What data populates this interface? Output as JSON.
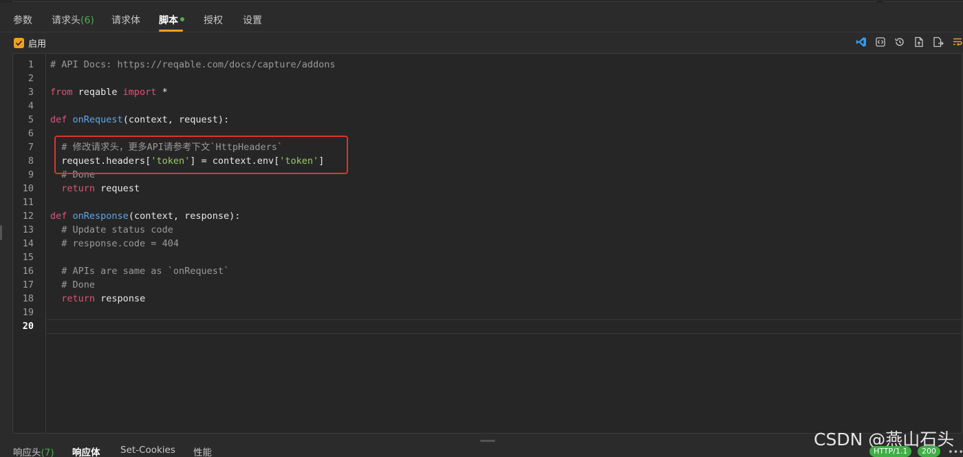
{
  "tabs": [
    {
      "label": "参数",
      "count": ""
    },
    {
      "label": "请求头",
      "count": "(6)"
    },
    {
      "label": "请求体",
      "count": ""
    },
    {
      "label": "脚本",
      "count": ""
    },
    {
      "label": "授权",
      "count": ""
    },
    {
      "label": "设置",
      "count": ""
    }
  ],
  "active_tab": "脚本",
  "enable": {
    "label": "启用",
    "checked": true
  },
  "toolbar_icons": [
    "vscode-icon",
    "code-brackets-icon",
    "history-icon",
    "file-export-icon",
    "file-output-icon",
    "word-wrap-icon"
  ],
  "editor": {
    "current_line": 20,
    "lines": [
      "1",
      "2",
      "3",
      "4",
      "5",
      "6",
      "7",
      "8",
      "9",
      "10",
      "11",
      "12",
      "13",
      "14",
      "15",
      "16",
      "17",
      "18",
      "19",
      "20"
    ],
    "code": {
      "l1": "# API Docs: https://reqable.com/docs/capture/addons",
      "l3_from": "from",
      "l3_mod": " reqable ",
      "l3_import": "import",
      "l3_star": " *",
      "l5_def": "def",
      "l5_fn": "onRequest",
      "l5_args": "(context, request):",
      "l7": "# 修改请求头，更多API请参考下文`HttpHeaders`",
      "l8_a": "request.headers[",
      "l8_s1": "'token'",
      "l8_b": "] = context.env[",
      "l8_s2": "'token'",
      "l8_c": "]",
      "l9": "# Done",
      "l10_kw": "return",
      "l10_rest": " request",
      "l12_def": "def",
      "l12_fn": "onResponse",
      "l12_args": "(context, response):",
      "l13": "# Update status code",
      "l14": "# response.code = 404",
      "l16": "# APIs are same as `onRequest`",
      "l17": "# Done",
      "l18_kw": "return",
      "l18_rest": " response"
    }
  },
  "bottom_tabs": [
    {
      "label": "响应头",
      "count": "(7)"
    },
    {
      "label": "响应体",
      "count": ""
    },
    {
      "label": "Set-Cookies",
      "count": ""
    },
    {
      "label": "性能",
      "count": ""
    }
  ],
  "status": {
    "protocol": "HTTP/1.1",
    "code": "200",
    "more": "•••"
  },
  "watermark": "CSDN @燕山石头",
  "colors": {
    "accent": "#f0a020",
    "success": "#4caf50",
    "keyword": "#e0527c",
    "function": "#5fa8e8",
    "string": "#9ccc65",
    "highlight_box": "#e0332c"
  }
}
